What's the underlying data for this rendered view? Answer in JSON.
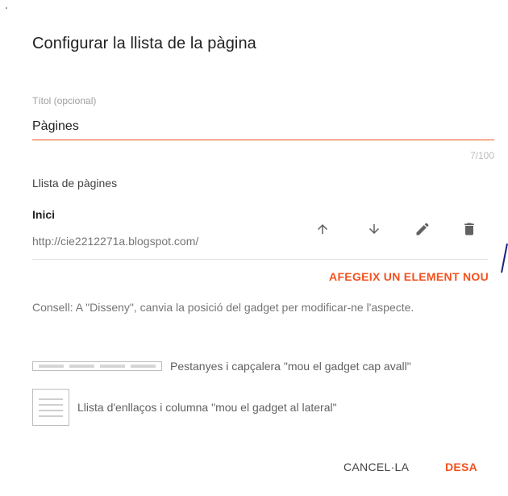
{
  "dialog": {
    "title": "Configurar la llista de la pàgina"
  },
  "title_field": {
    "label": "Títol (opcional)",
    "value": "Pàgines",
    "counter": "7/100"
  },
  "pages": {
    "section_label": "Llista de pàgines",
    "items": [
      {
        "name": "Inici",
        "url": "http://cie2212271a.blogspot.com/",
        "actions": [
          "arrow-up-icon",
          "arrow-down-icon",
          "pencil-icon",
          "trash-icon"
        ]
      }
    ],
    "add_label": "AFEGEIX UN ELEMENT NOU"
  },
  "hint": {
    "text": "Consell: A \"Disseny\", canvia la posició del gadget per modificar-ne l'aspecte."
  },
  "layout_options": {
    "tabs_label": "Pestanyes i capçalera \"mou el gadget cap avall\"",
    "list_label": "Llista d'enllaços i columna \"mou el gadget al lateral\""
  },
  "footer": {
    "cancel_label": "CANCEL·LA",
    "save_label": "DESA"
  },
  "colors": {
    "accent": "#f4511e",
    "text_primary": "#212121",
    "text_secondary": "#757575",
    "edge_mark": "#1a237e"
  }
}
